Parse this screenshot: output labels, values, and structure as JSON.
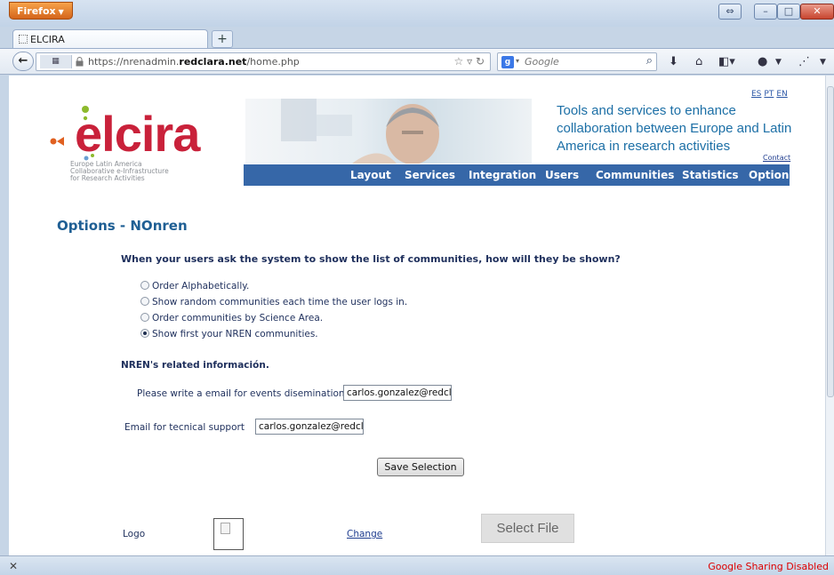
{
  "browser": {
    "menu_button": "Firefox",
    "tab_title": "ELCIRA",
    "url_prefix": "https://nrenadmin.",
    "url_domain": "redclara.net",
    "url_path": "/home.php",
    "search_placeholder": "Google",
    "status_text": "Google Sharing Disabled"
  },
  "header": {
    "lang_links": [
      "ES",
      "PT",
      "EN"
    ],
    "logo_text": "elcira",
    "logo_sub": [
      "Europe Latin America",
      "Collaborative e-Infrastructure",
      "for Research Activities"
    ],
    "tagline": "Tools and services to enhance collaboration between Europe and Latin America in research activities",
    "contact": "Contact"
  },
  "menu": [
    "Layout",
    "Services",
    "Integration",
    "Users",
    "Communities",
    "Statistics",
    "Options"
  ],
  "main": {
    "title": "Options - NOnren",
    "question": "When your users ask the system to show the list of communities, how will they be shown?",
    "options": [
      {
        "label": "Order Alphabetically.",
        "selected": false
      },
      {
        "label": "Show random communities each time the user logs in.",
        "selected": false
      },
      {
        "label": "Order communities by Science Area.",
        "selected": false
      },
      {
        "label": "Show first your NREN communities.",
        "selected": true
      }
    ],
    "related_heading": "NREN's related información.",
    "events_email_label": "Please write a email for events diseminations.",
    "events_email_value": "carlos.gonzalez@redcla",
    "support_email_label": "Email for tecnical support",
    "support_email_value": "carlos.gonzalez@redcla",
    "save_button": "Save Selection",
    "logo_label": "Logo",
    "change_link": "Change",
    "select_file_button": "Select File"
  }
}
